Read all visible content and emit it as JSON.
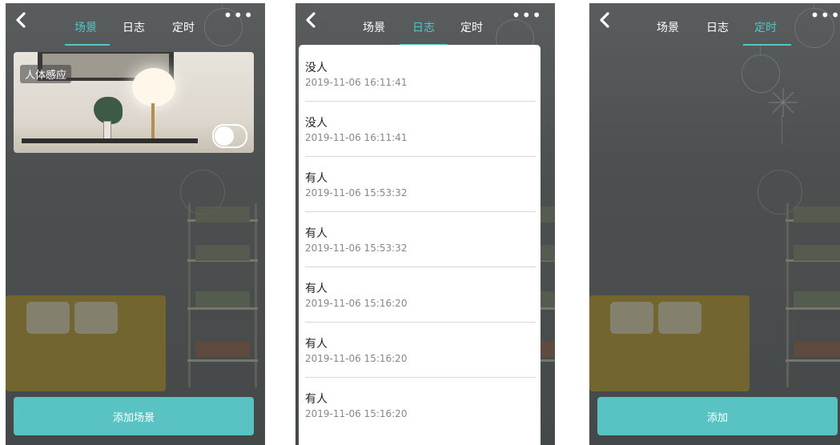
{
  "panels": [
    {
      "tabs": [
        "场景",
        "日志",
        "定时"
      ],
      "active_tab": 0,
      "scene_card": {
        "title": "人体感应",
        "toggle_on": false
      },
      "bottom_button": "添加场景"
    },
    {
      "tabs": [
        "场景",
        "日志",
        "定时"
      ],
      "active_tab": 1,
      "log_entries": [
        {
          "status": "没人",
          "time": "2019-11-06 16:11:41"
        },
        {
          "status": "没人",
          "time": "2019-11-06 16:11:41"
        },
        {
          "status": "有人",
          "time": "2019-11-06 15:53:32"
        },
        {
          "status": "有人",
          "time": "2019-11-06 15:53:32"
        },
        {
          "status": "有人",
          "time": "2019-11-06 15:16:20"
        },
        {
          "status": "有人",
          "time": "2019-11-06 15:16:20"
        },
        {
          "status": "有人",
          "time": "2019-11-06 15:16:20"
        }
      ]
    },
    {
      "tabs": [
        "场景",
        "日志",
        "定时"
      ],
      "active_tab": 2,
      "bottom_button": "添加"
    }
  ],
  "icons": {
    "back": "chevron-left-icon",
    "more": "more-dots-icon"
  },
  "colors": {
    "accent": "#59c3c3",
    "tab_active": "#52c7c9"
  }
}
